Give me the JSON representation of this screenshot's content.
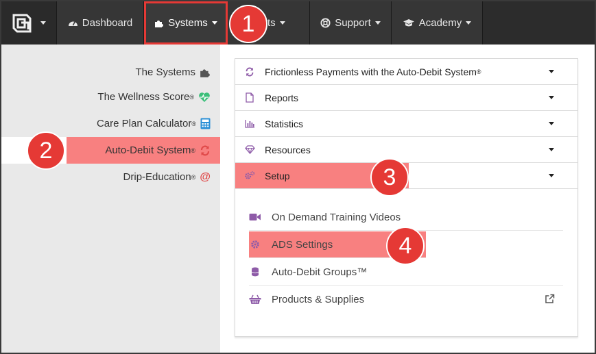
{
  "nav": {
    "dashboard": "Dashboard",
    "systems": "Systems",
    "clients": "ients",
    "support": "Support",
    "academy": "Academy"
  },
  "badges": [
    "1",
    "2",
    "3",
    "4"
  ],
  "sidebar": {
    "items": [
      {
        "label": "The Systems",
        "icon": "puzzle-icon",
        "reg": false
      },
      {
        "label": "The Wellness Score",
        "icon": "heartbeat-icon",
        "reg": true
      },
      {
        "label": "Care Plan Calculator",
        "icon": "calculator-icon",
        "reg": true
      },
      {
        "label": "Auto-Debit System",
        "icon": "refresh-icon",
        "reg": true,
        "active": true
      },
      {
        "label": "Drip-Education",
        "icon": "at-sign-icon",
        "reg": true
      }
    ],
    "reg_mark": "®"
  },
  "accordion": {
    "items": [
      {
        "label": "Frictionless Payments with the Auto-Debit System",
        "reg": true,
        "icon": "refresh-icon"
      },
      {
        "label": "Reports",
        "icon": "file-icon"
      },
      {
        "label": "Statistics",
        "icon": "bar-chart-icon"
      },
      {
        "label": "Resources",
        "icon": "diamond-icon"
      },
      {
        "label": "Setup",
        "icon": "gears-icon",
        "active": true
      }
    ]
  },
  "setup_items": [
    {
      "label": "On Demand Training Videos",
      "icon": "video-camera-icon"
    },
    {
      "label": "ADS Settings",
      "icon": "gear-icon",
      "active": true
    },
    {
      "label": "Auto-Debit Groups™",
      "icon": "database-icon"
    },
    {
      "label": "Products & Supplies",
      "icon": "basket-icon",
      "external": true
    }
  ],
  "colors": {
    "highlight": "#f88080",
    "badge": "#e53935",
    "navbar": "#2c2c2c",
    "icon_purple": "#8e5ba8",
    "heart_green": "#3cbf7a",
    "calc_blue": "#2a8fd6",
    "accent_red": "#e04a4a"
  }
}
